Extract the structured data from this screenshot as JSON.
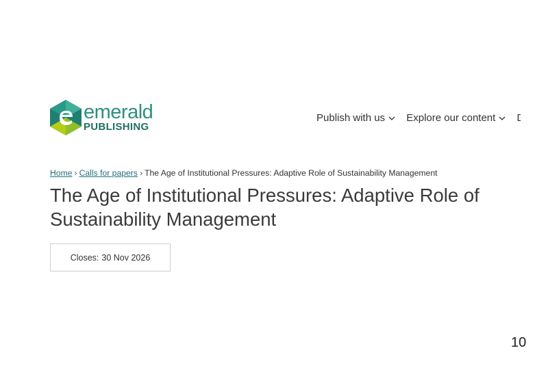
{
  "logo": {
    "word": "emerald",
    "sub": "PUBLISHING"
  },
  "nav": {
    "items": [
      {
        "label": "Publish with us"
      },
      {
        "label": "Explore our content"
      },
      {
        "label": "D"
      }
    ]
  },
  "breadcrumb": {
    "home": "Home",
    "calls": "Calls for papers",
    "current": "The Age of Institutional Pressures: Adaptive Role of Sustainability Management",
    "separator": "›"
  },
  "page": {
    "title": "The Age of Institutional Pressures: Adaptive Role of Sustainability Management"
  },
  "closes": {
    "label": "Closes:",
    "date": "30 Nov 2026"
  },
  "page_number": "10",
  "colors": {
    "brand_teal": "#2f8f7f",
    "brand_dark": "#1f6f63",
    "brand_lime": "#b5cc18",
    "link": "#1f6f7a"
  },
  "icons": [
    "emerald-logo-icon",
    "chevron-down-icon"
  ]
}
